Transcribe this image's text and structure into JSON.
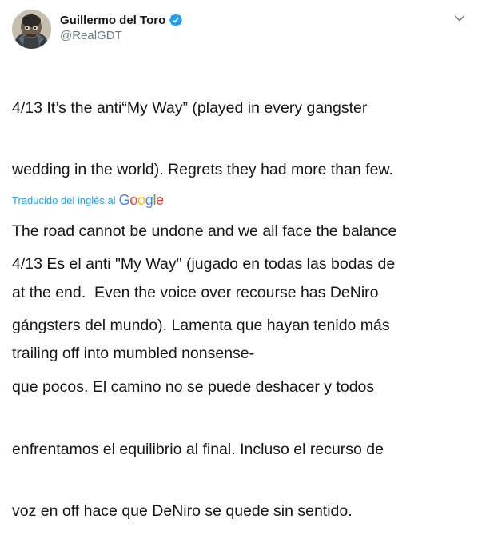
{
  "author": {
    "display_name": "Guillermo del Toro",
    "handle": "@RealGDT",
    "verified": true
  },
  "tweet": {
    "text_lines": [
      "4/13 It’s the anti“My Way” (played in every gangster",
      "wedding in the world). Regrets they had more than few.",
      "The road cannot be undone and we all face the balance",
      "at the end.  Even the voice over recourse has DeNiro",
      "trailing off into mumbled nonsense-"
    ]
  },
  "translation": {
    "label": "Traducido del inglés al",
    "provider": "Google",
    "text_lines": [
      "4/13 Es el anti \"My Way\" (jugado en todas las bodas de",
      "gángsters del mundo). Lamenta que hayan tenido más",
      "que pocos. El camino no se puede deshacer y todos",
      "enfrentamos el equilibrio al final. Incluso el recurso de",
      "voz en off hace que DeNiro se quede sin sentido."
    ]
  },
  "colors": {
    "text": "#14171a",
    "secondary": "#657786",
    "accent": "#1da1f2",
    "google_blue": "#4285f4",
    "google_red": "#ea4335",
    "google_yellow": "#fbbc05",
    "google_green": "#34a853"
  },
  "icons": {
    "verified": "verified-badge-icon",
    "menu": "chevron-down-icon",
    "avatar": "avatar"
  }
}
